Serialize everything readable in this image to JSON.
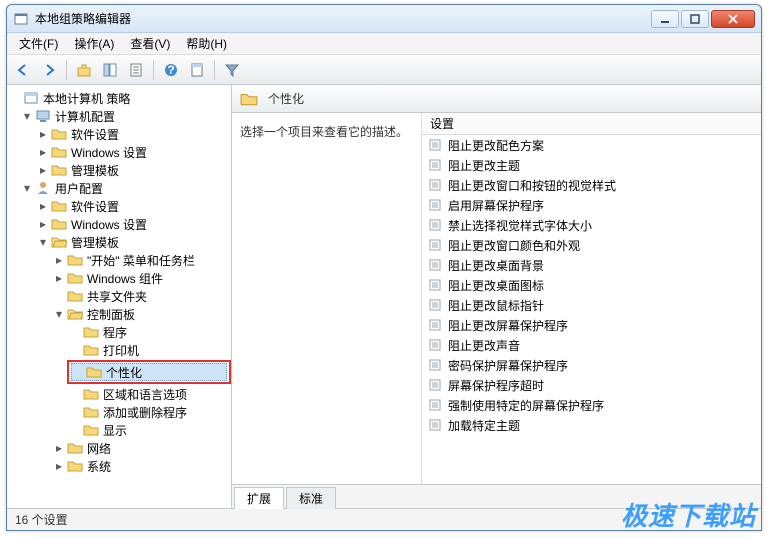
{
  "window": {
    "title": "本地组策略编辑器"
  },
  "menu": {
    "file": "文件(F)",
    "action": "操作(A)",
    "view": "查看(V)",
    "help": "帮助(H)"
  },
  "tree": {
    "root": "本地计算机 策略",
    "computer_config": "计算机配置",
    "cc_software": "软件设置",
    "cc_windows": "Windows 设置",
    "cc_admin": "管理模板",
    "user_config": "用户配置",
    "uc_software": "软件设置",
    "uc_windows": "Windows 设置",
    "uc_admin": "管理模板",
    "start_taskbar": "\"开始\" 菜单和任务栏",
    "win_components": "Windows 组件",
    "shared_folders": "共享文件夹",
    "control_panel": "控制面板",
    "cp_programs": "程序",
    "cp_printers": "打印机",
    "cp_personalization": "个性化",
    "cp_region_lang": "区域和语言选项",
    "cp_add_remove": "添加或删除程序",
    "cp_display": "显示",
    "network": "网络",
    "system": "系统"
  },
  "header": {
    "title": "个性化"
  },
  "desc": {
    "text": "选择一个项目来查看它的描述。"
  },
  "list": {
    "column": "设置",
    "items": [
      "阻止更改配色方案",
      "阻止更改主题",
      "阻止更改窗口和按钮的视觉样式",
      "启用屏幕保护程序",
      "禁止选择视觉样式字体大小",
      "阻止更改窗口颜色和外观",
      "阻止更改桌面背景",
      "阻止更改桌面图标",
      "阻止更改鼠标指针",
      "阻止更改屏幕保护程序",
      "阻止更改声音",
      "密码保护屏幕保护程序",
      "屏幕保护程序超时",
      "强制使用特定的屏幕保护程序",
      "加载特定主题"
    ]
  },
  "tabs": {
    "extended": "扩展",
    "standard": "标准"
  },
  "status": {
    "text": "16 个设置"
  },
  "watermark": "极速下载站"
}
